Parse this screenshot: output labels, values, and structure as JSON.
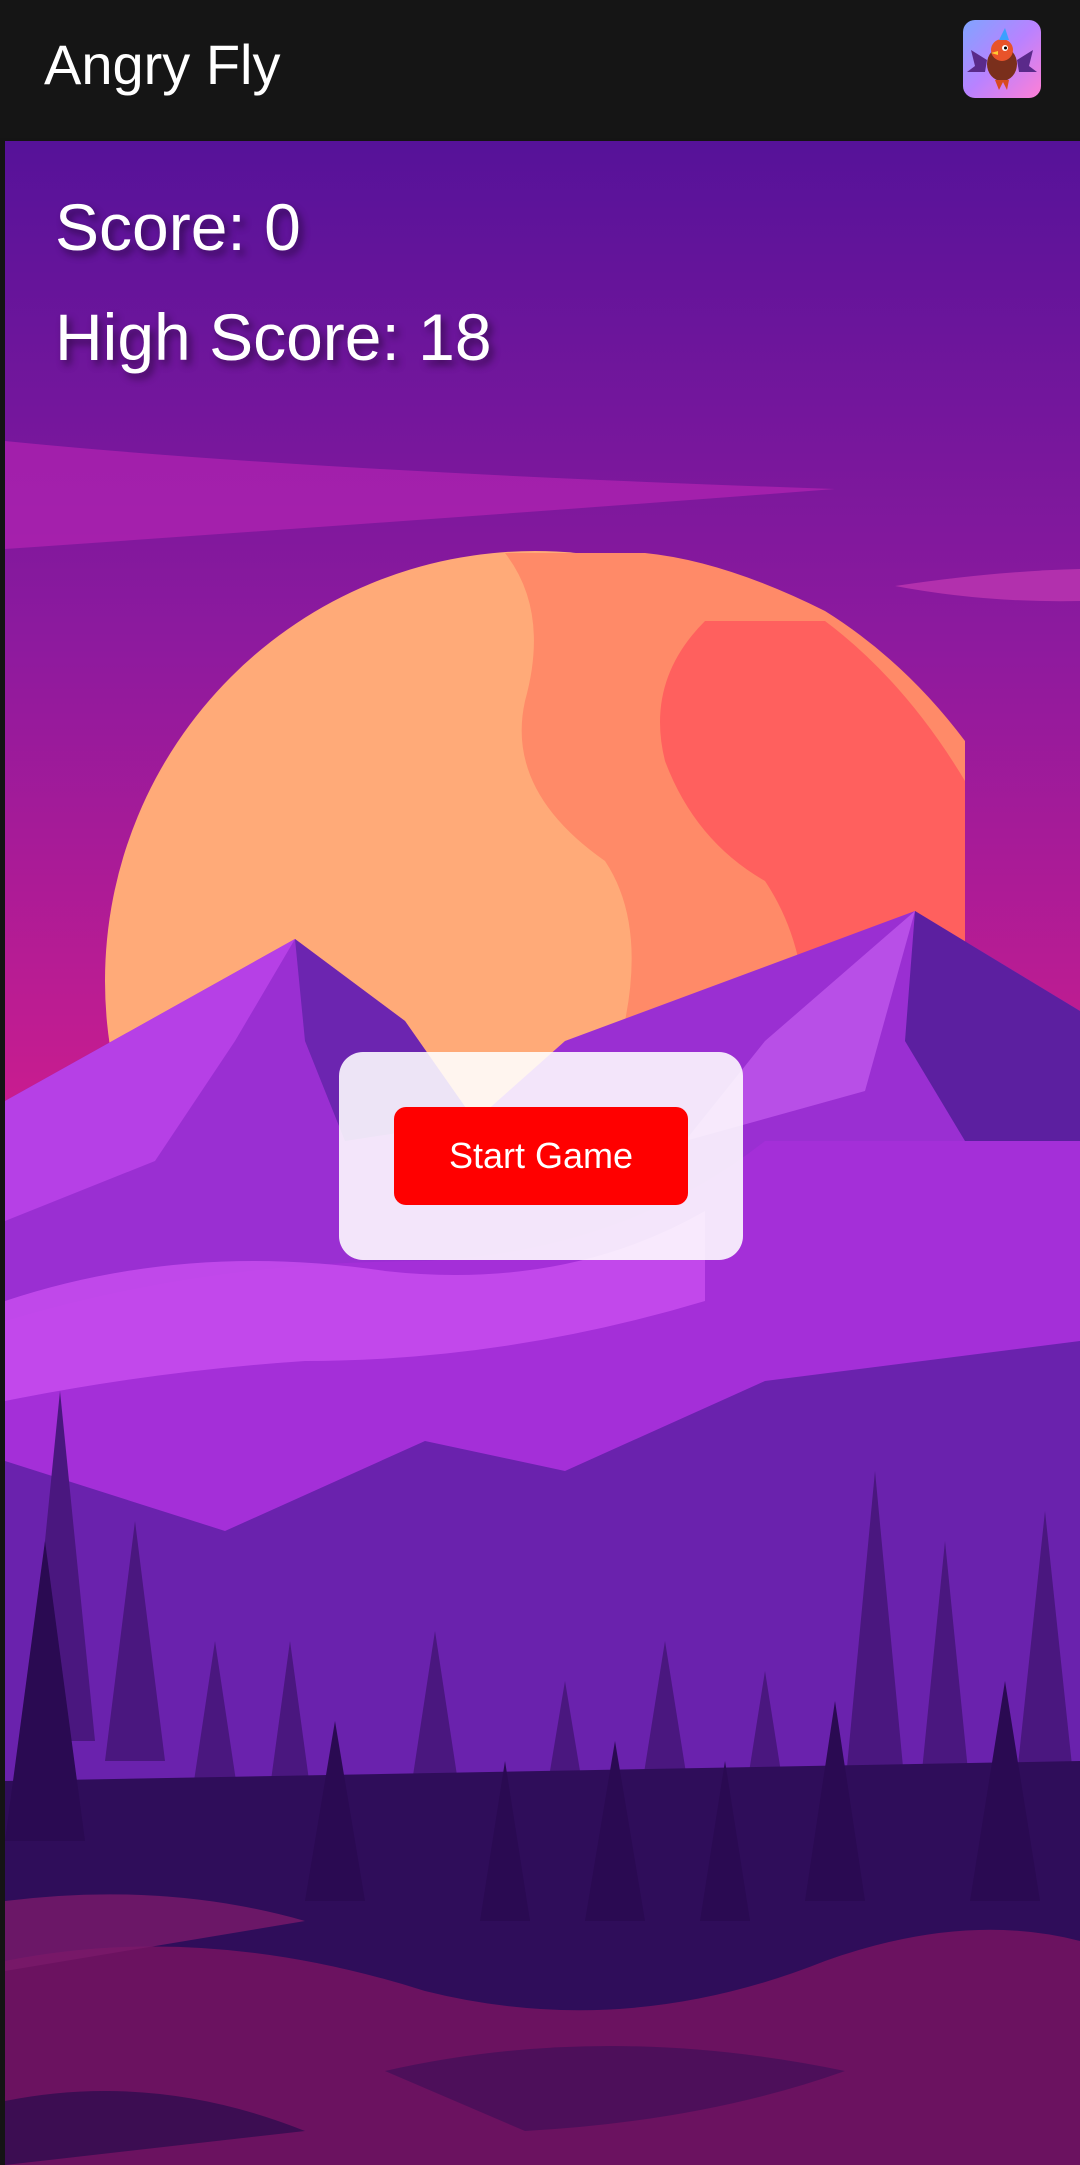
{
  "appbar": {
    "title": "Angry Fly",
    "icon": "angry-bird-app-icon"
  },
  "game": {
    "score_label": "Score: 0",
    "high_score_label": "High Score: 18",
    "score": 0,
    "high_score": 18,
    "background": "sunset-mountains-forest"
  },
  "menu": {
    "start_button_label": "Start Game"
  },
  "colors": {
    "appbar_bg": "#151515",
    "sky_top": "#5a139a",
    "sky_bottom": "#ff1e78",
    "sun_light": "#ffaa78",
    "sun_dark": "#ff5c5c",
    "start_button": "#ff0000",
    "panel": "#ffffff"
  }
}
